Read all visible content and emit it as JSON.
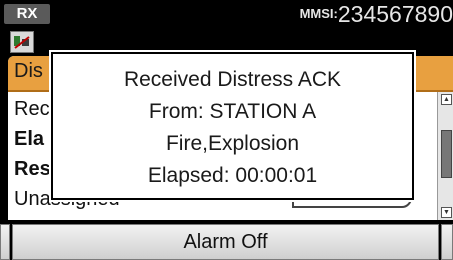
{
  "status_bar": {
    "rx_label": "RX",
    "mmsi_key": "MMSI:",
    "mmsi_value": "234567890"
  },
  "background_window": {
    "title": "Dis",
    "rows": [
      "Rec",
      "Ela",
      "Res",
      "Unassigned"
    ]
  },
  "dialog": {
    "line1": "Received Distress ACK",
    "line2": "From: STATION A",
    "line3": "Fire,Explosion",
    "line4": "Elapsed: 00:00:01"
  },
  "softkeys": {
    "left_label": "",
    "center_label": "Alarm Off",
    "right_label": ""
  },
  "colors": {
    "title_bar": "#e8a040",
    "rx_badge": "#5a5a5a",
    "background": "#000000"
  },
  "icons": {
    "status": "radio-icon"
  }
}
